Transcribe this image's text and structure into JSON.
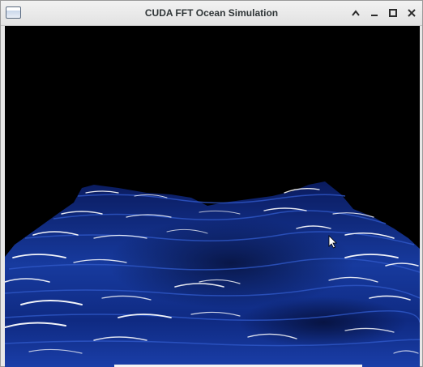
{
  "window": {
    "title": "CUDA FFT Ocean Simulation",
    "icon": "application-window-icon",
    "controls": [
      "minimize-up-icon",
      "minimize-icon",
      "maximize-icon",
      "close-icon"
    ]
  },
  "canvas": {
    "content": "ocean-surface-render",
    "colors": {
      "sky": "#000000",
      "water_deep": "#0b1f6a",
      "water_mid": "#1a3ea8",
      "highlight": "#ffffff"
    }
  }
}
